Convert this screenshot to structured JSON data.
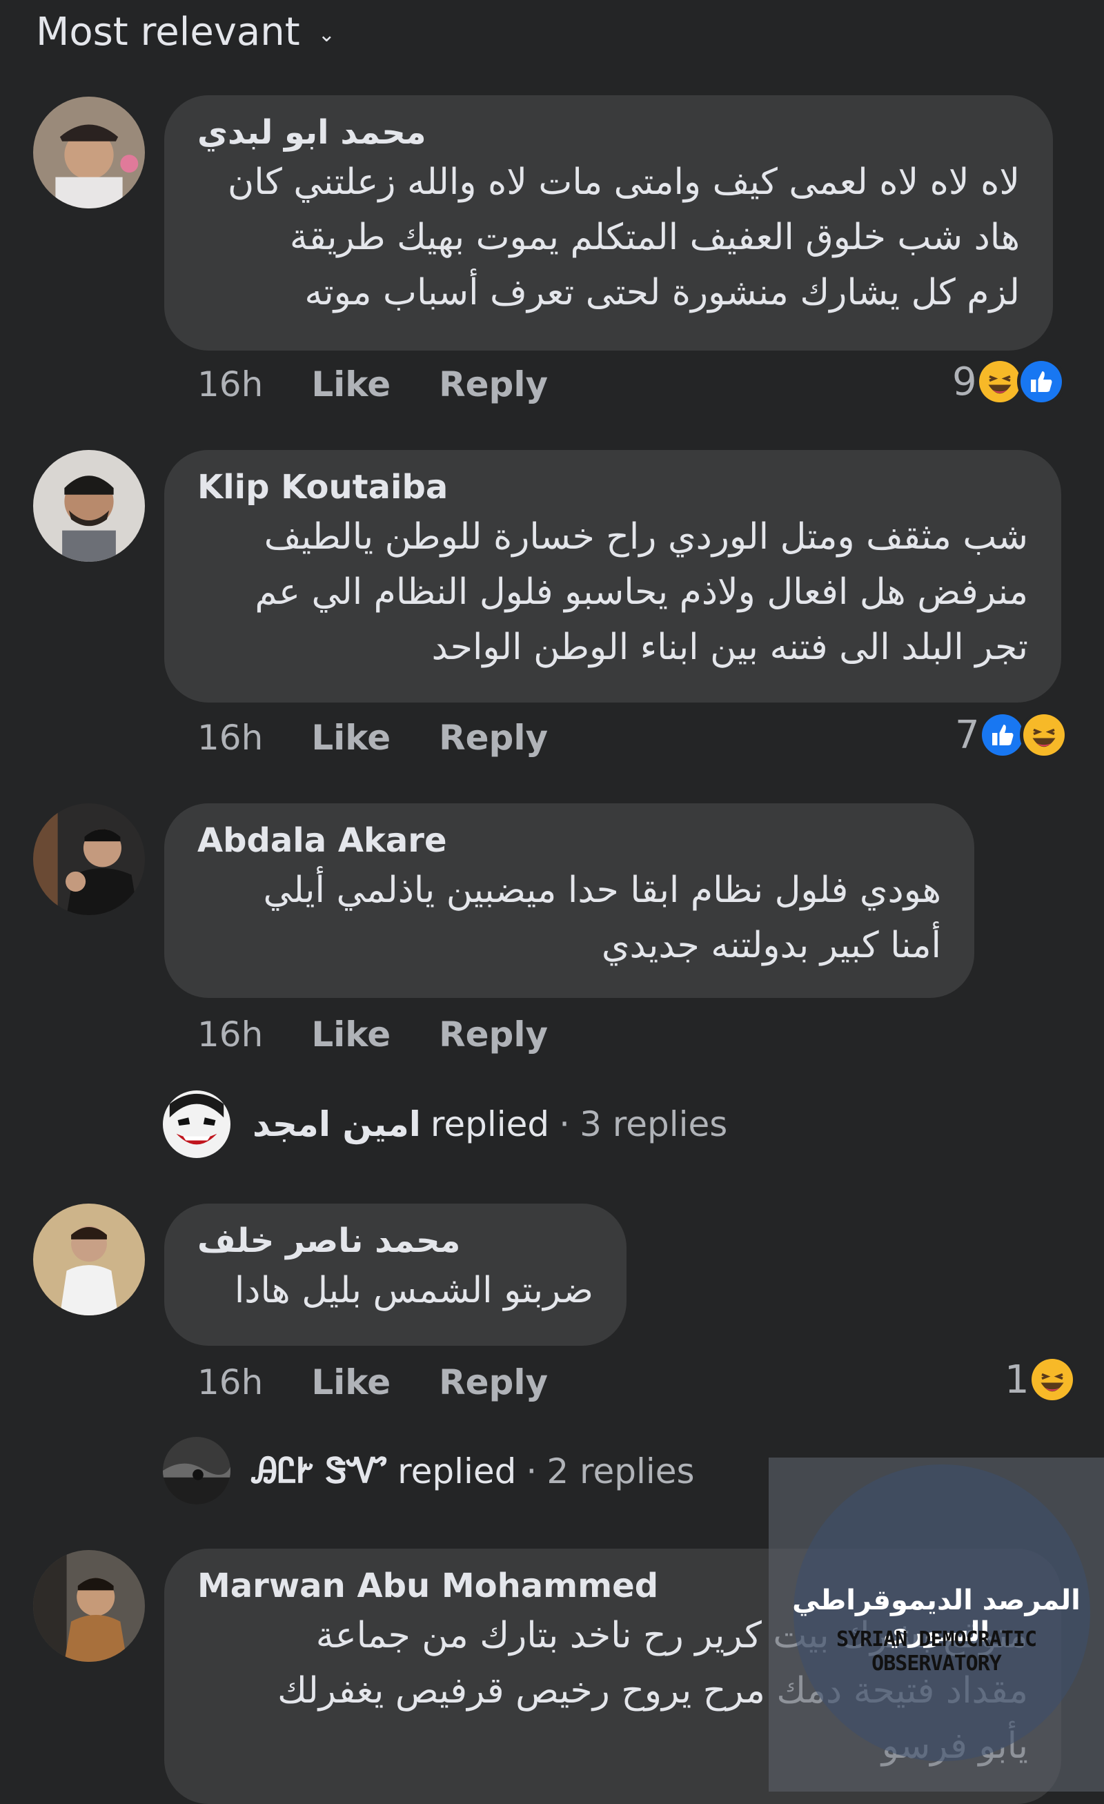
{
  "header": {
    "title": "Most relevant",
    "chevron_icon": "chevron-down-icon"
  },
  "colors": {
    "background": "#242526",
    "bubble": "#3a3b3c",
    "text": "#e4e6eb",
    "muted": "#b0b3b8",
    "like_blue": "#1877f2",
    "haha_yellow": "#f7b928"
  },
  "comments": [
    {
      "author": "محمد ابو لبدي",
      "text": "لاه لاه لاه لعمى كيف وامتى مات لاه والله زعلتني كان\nهاد شب خلوق العفيف المتكلم يموت بهيك طريقة\nلزم كل يشارك منشورة لحتى تعرف أسباب موته",
      "time": "16h",
      "like": "Like",
      "reply": "Reply",
      "reaction_count": "9",
      "reactions": [
        "haha-icon",
        "like-icon"
      ]
    },
    {
      "author": "Klip Koutaiba",
      "text": "شب مثقف ومتل الوردي راح خسارة للوطن يالطيف\nمنرفض هل افعال ولاذم يحاسبو فلول النظام الي عم\nتجر البلد الى فتنه بين ابناء الوطن الواحد",
      "time": "16h",
      "like": "Like",
      "reply": "Reply",
      "reaction_count": "7",
      "reactions": [
        "like-icon",
        "haha-icon"
      ]
    },
    {
      "author": "Abdala Akare",
      "text": "هودي فلول نظام ابقا حدا ميضبين ياذلمي أيلي\nأمنا كبير بدولتنه جديدي",
      "time": "16h",
      "like": "Like",
      "reply": "Reply",
      "replies": {
        "name": "امين امجد",
        "replied": "replied",
        "sep": "·",
        "count_text": "3 replies"
      }
    },
    {
      "author": "محمد ناصر خلف",
      "text": "ضربتو الشمس بليل هادا",
      "time": "16h",
      "like": "Like",
      "reply": "Reply",
      "reaction_count": "1",
      "reactions": [
        "haha-icon"
      ],
      "replies": {
        "name": "ᎯᏝᎨ ᏕᏉ",
        "replied": "replied",
        "sep": "·",
        "count_text": "2 replies"
      }
    },
    {
      "author": "Marwan Abu Mohammed",
      "text": "متوقع بشرك بيت كرير رح ناخد بتارك من جماعة\nمقداد فتيحة دمك مرح يروح رخيص قرفيص يغفرلك\nيأبو فرسو"
    }
  ],
  "watermark": {
    "arabic": "المرصد الديموقراطي السوري",
    "english": "SYRIAN DEMOCRATIC OBSERVATORY"
  }
}
